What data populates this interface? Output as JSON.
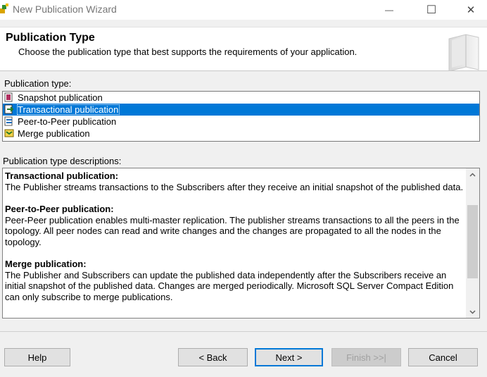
{
  "window": {
    "title": "New Publication Wizard",
    "minimize_glyph": "—",
    "maximize_glyph": "☐",
    "close_glyph": "✕"
  },
  "header": {
    "title": "Publication Type",
    "subtitle": "Choose the publication type that best supports the requirements of your application."
  },
  "publication_types": {
    "label": "Publication type:",
    "items": [
      {
        "label": "Snapshot publication",
        "icon": "snapshot-icon",
        "selected": false
      },
      {
        "label": "Transactional publication",
        "icon": "transactional-icon",
        "selected": true
      },
      {
        "label": "Peer-to-Peer publication",
        "icon": "peer-to-peer-icon",
        "selected": false
      },
      {
        "label": "Merge publication",
        "icon": "merge-icon",
        "selected": false
      }
    ]
  },
  "descriptions": {
    "label": "Publication type descriptions:",
    "sections": [
      {
        "heading": "Transactional publication:",
        "text": "The Publisher streams transactions to the Subscribers after they receive an initial snapshot of the published data."
      },
      {
        "heading": "Peer-to-Peer publication:",
        "text": "Peer-Peer publication enables multi-master replication. The publisher streams transactions to all the peers in the topology. All peer nodes can read and write changes and the changes are propagated to all the nodes in the topology."
      },
      {
        "heading": "Merge publication:",
        "text": "The Publisher and Subscribers can update the published data independently after the Subscribers receive an initial snapshot of the published data. Changes are merged periodically. Microsoft SQL Server Compact Edition can only subscribe to merge publications."
      }
    ]
  },
  "buttons": {
    "help": "Help",
    "back": "< Back",
    "next": "Next >",
    "finish": "Finish >>|",
    "cancel": "Cancel"
  },
  "colors": {
    "selection": "#0078d7",
    "dialog_bg": "#f0f0f0"
  }
}
